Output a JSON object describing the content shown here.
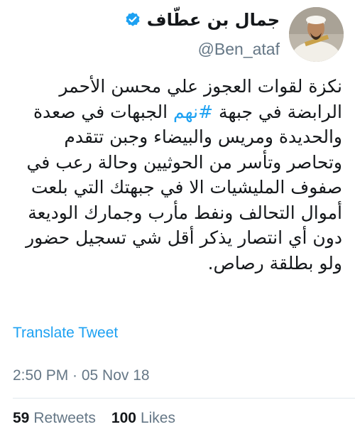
{
  "profile": {
    "display_name": "جمال بن عطّاف",
    "handle": "@Ben_ataf",
    "verified": true
  },
  "tweet": {
    "text_before_hashtag": "نكزة لقوات العجوز علي محسن الأحمر الرابضة في جبهة ",
    "hashtag": "#نهم",
    "text_after_hashtag": " الجبهات في صعدة والحديدة ومريس والبيضاء وجبن تتقدم وتحاصر وتأسر من الحوثيين وحالة رعب في صفوف المليشيات الا في جبهتك التي بلعت أموال التحالف ونفط مأرب وجمارك الوديعة دون أي انتصار يذكر أقل شي تسجيل حضور ولو بطلقة رصاص."
  },
  "translate_label": "Translate Tweet",
  "timestamp": "2:50 PM · 05 Nov 18",
  "stats": {
    "retweets_count": "59",
    "retweets_label": "Retweets",
    "likes_count": "100",
    "likes_label": "Likes"
  },
  "colors": {
    "link": "#1da1f2",
    "secondary_text": "#657786",
    "primary_text": "#14171a"
  },
  "icons": {
    "verified": "verified-badge-icon"
  }
}
